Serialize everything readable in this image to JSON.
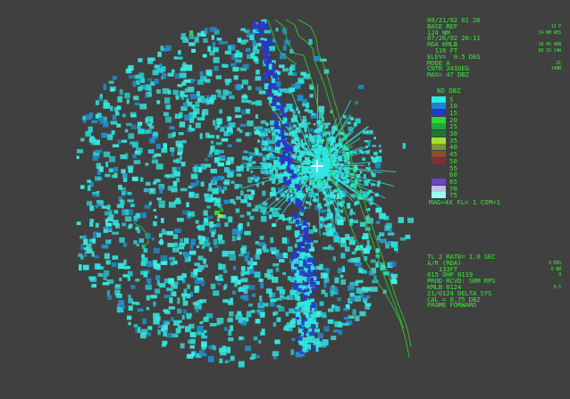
{
  "header_panel": {
    "lines": [
      {
        "left": "09/21/92 01 26",
        "right": ""
      },
      {
        "left": "BASE REF",
        "right": "13 P"
      },
      {
        "left": "124 NM",
        "right": "54 NM RES"
      },
      {
        "left": "07/26/92 20:11",
        "right": ""
      },
      {
        "left": "RDA KMLB",
        "right": "28 06 46N"
      },
      {
        "left": "  116 FT",
        "right": "80 39 14W"
      },
      {
        "left": "ELEV=  0.5 DEG",
        "right": ""
      },
      {
        "left": "MODE A",
        "right": "21"
      },
      {
        "left": "CNTR 241DEG",
        "right": "14NM"
      },
      {
        "left": "MAX= 47 DBZ",
        "right": ""
      }
    ]
  },
  "legend": {
    "title": "ND DBZ",
    "items": [
      {
        "label": "5",
        "color": "#30e8e0"
      },
      {
        "label": "10",
        "color": "#2080d8"
      },
      {
        "label": "15",
        "color": "#2838c8"
      },
      {
        "label": "20",
        "color": "#30d830"
      },
      {
        "label": "25",
        "color": "#20a838"
      },
      {
        "label": "30",
        "color": "#207830"
      },
      {
        "label": "35",
        "color": "#a8e030"
      },
      {
        "label": "40",
        "color": "#789828"
      },
      {
        "label": "45",
        "color": "#885028"
      },
      {
        "label": "50",
        "color": "#803030"
      },
      {
        "label": "55",
        "color": ""
      },
      {
        "label": "60",
        "color": ""
      },
      {
        "label": "65",
        "color": "#6848c8"
      },
      {
        "label": "70",
        "color": "#c0c0e8"
      },
      {
        "label": "75",
        "color": "#a0f8f0"
      }
    ]
  },
  "mag_line": "MAG=4X FL= 1 COM=1",
  "footer_panel": {
    "lines": [
      {
        "left": "TL 2 RATE= 1.0 SEC",
        "right": ""
      },
      {
        "left": "A/R (RDA)",
        "right": "0 DEG"
      },
      {
        "left": "   133FT",
        "right": "0 NM"
      },
      {
        "left": "015 OHP 0119",
        "right": "8"
      },
      {
        "left": "PROD RCVD: SRM RPS",
        "right": ""
      },
      {
        "left": "KMLB 0124",
        "right": "0.5"
      },
      {
        "left": "21/0124 DELTA SYS",
        "right": ""
      },
      {
        "left": "CAL = 0.75 DBZ",
        "right": ""
      },
      {
        "left": "FRAME FORWARD",
        "right": ""
      }
    ]
  },
  "colors": {
    "background": "#404040",
    "text": "#38e838",
    "coastline": "#30c830",
    "echo_main": "#30e8e0",
    "echo_band": "#2838c8",
    "radar_site": "#e0f0ff"
  }
}
